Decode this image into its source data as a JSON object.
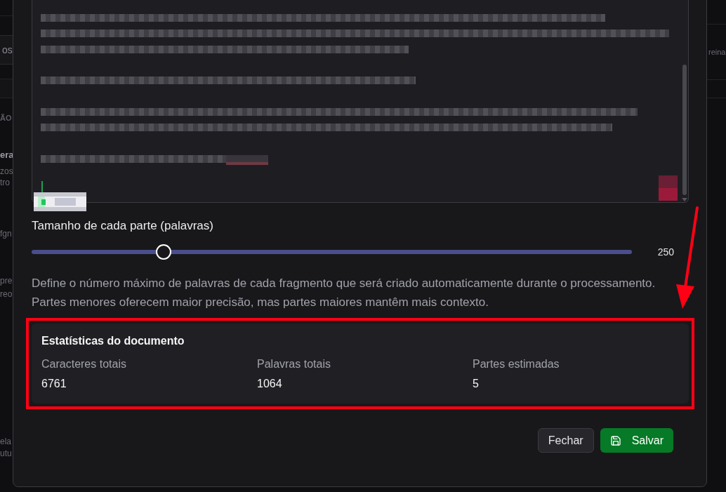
{
  "background_page": {
    "left_edge": [
      {
        "kind": "field",
        "texts": [
          "os"
        ]
      },
      {
        "kind": "section",
        "texts": [
          "ÃO"
        ]
      },
      {
        "kind": "heading",
        "texts": [
          "era"
        ]
      },
      {
        "kind": "text",
        "texts": [
          "zos",
          "tro"
        ]
      },
      {
        "kind": "text",
        "texts": [
          "fgn"
        ]
      },
      {
        "kind": "text",
        "texts": [
          "pre",
          "reo"
        ]
      },
      {
        "kind": "text",
        "texts": [
          "ela",
          "utu"
        ]
      }
    ],
    "right_edge": [
      {
        "kind": "text",
        "texts": [
          "reina"
        ]
      }
    ]
  },
  "dialog": {
    "chunk_size": {
      "label": "Tamanho de cada parte (palavras)",
      "level": 0.22,
      "reading": "250"
    },
    "description": [
      "Define o número máximo de palavras de cada fragmento que será criado automaticamente durante o processamento.",
      "Partes menores oferecem maior precisão, mas partes maiores mantêm mais contexto."
    ],
    "statistics": {
      "title": "Estatísticas do documento",
      "items": [
        {
          "label": "Caracteres totais",
          "value": "6761"
        },
        {
          "label": "Palavras totais",
          "value": "1064"
        },
        {
          "label": "Partes estimadas",
          "value": "5"
        }
      ]
    },
    "buttons": [
      {
        "kind": "secondary",
        "label": "Fechar"
      },
      {
        "kind": "primary",
        "label": "Salvar"
      }
    ]
  }
}
